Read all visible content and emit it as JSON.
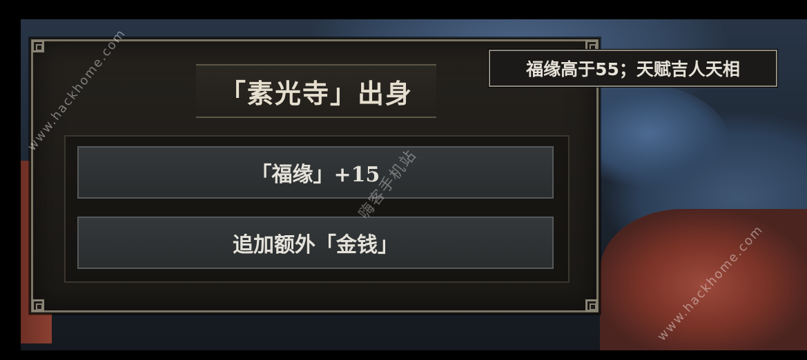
{
  "event": {
    "title": "「素光寺」出身",
    "options": [
      {
        "label": "「福缘」+15"
      },
      {
        "label": "追加额外「金钱」"
      }
    ]
  },
  "tooltip": {
    "text": "福缘高于55；天赋吉人天相"
  },
  "watermarks": {
    "top_left": "www.hackhome.com",
    "bottom_right": "www.hackhome.com",
    "center": "嗨客手机站"
  }
}
